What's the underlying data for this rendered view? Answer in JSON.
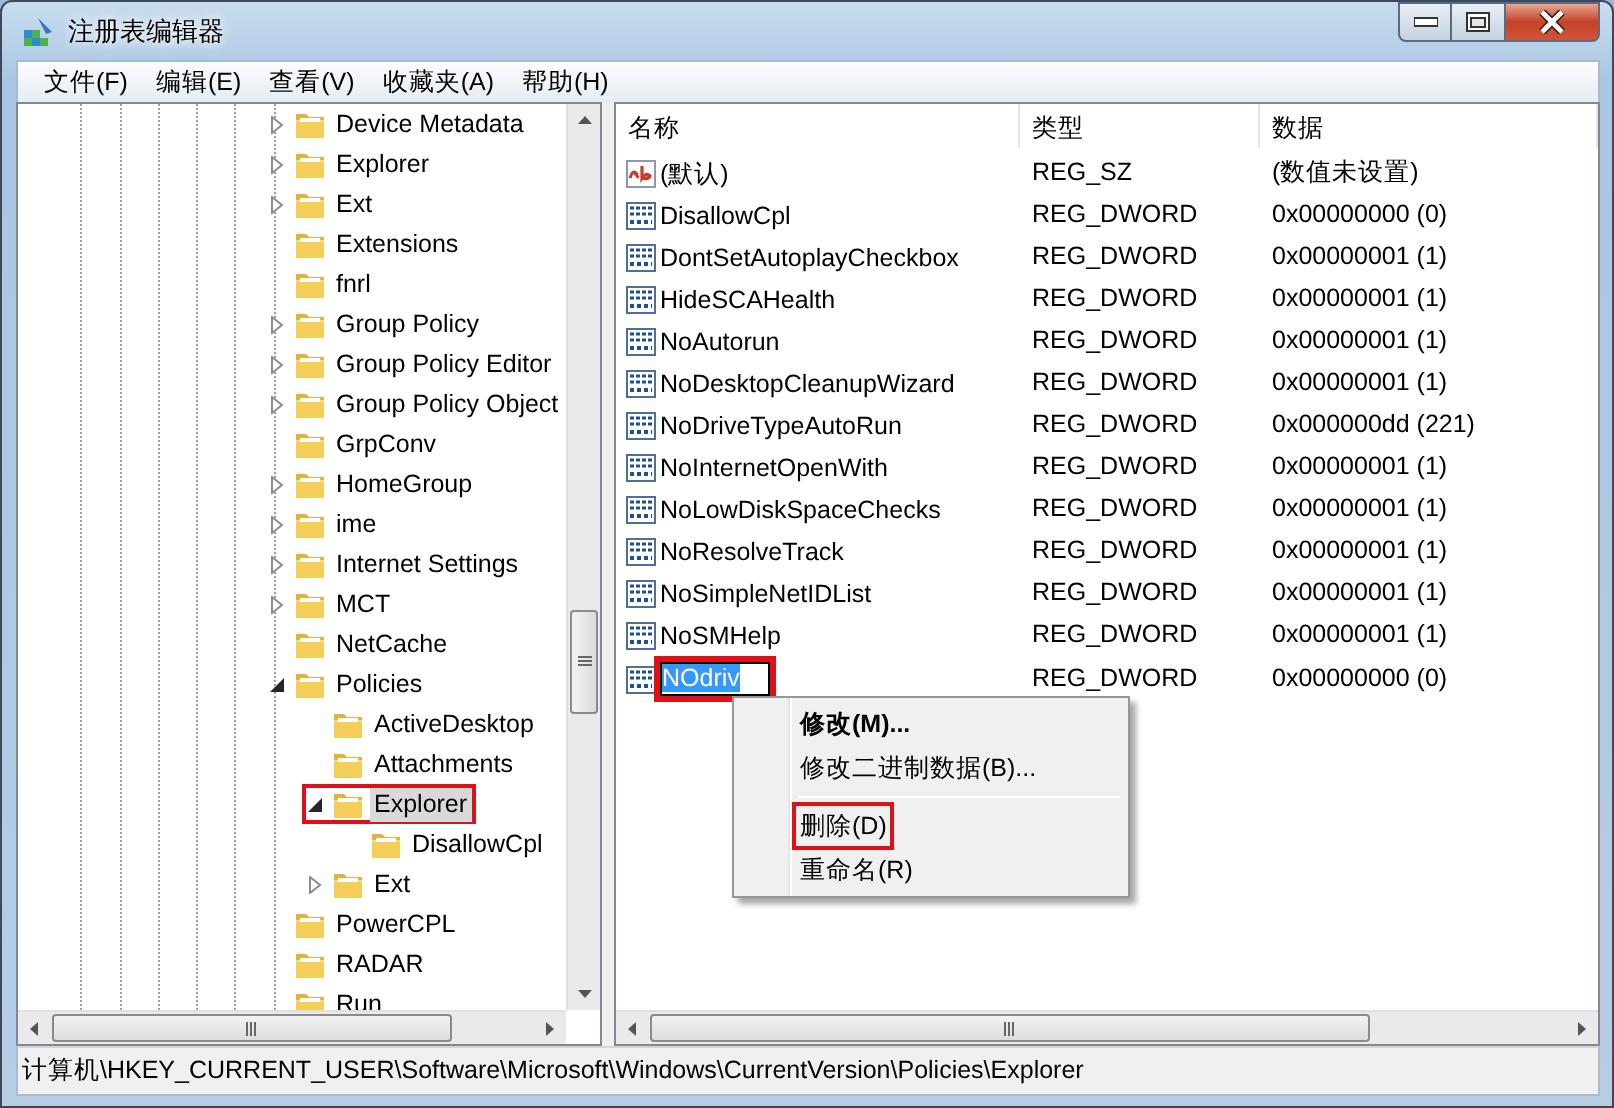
{
  "window": {
    "title": "注册表编辑器"
  },
  "menu": [
    "文件(F)",
    "编辑(E)",
    "查看(V)",
    "收藏夹(A)",
    "帮助(H)"
  ],
  "tree": [
    {
      "label": "Device Metadata",
      "kind": "branch",
      "expanded": false,
      "selected": false,
      "marked": false
    },
    {
      "label": "Explorer",
      "kind": "branch",
      "expanded": false,
      "selected": false,
      "marked": false
    },
    {
      "label": "Ext",
      "kind": "branch",
      "expanded": false,
      "selected": false,
      "marked": false
    },
    {
      "label": "Extensions",
      "kind": "leaf",
      "selected": false,
      "marked": false
    },
    {
      "label": "fnrl",
      "kind": "leaf",
      "selected": false,
      "marked": false
    },
    {
      "label": "Group Policy",
      "kind": "branch",
      "expanded": false,
      "selected": false,
      "marked": false
    },
    {
      "label": "Group Policy Editor",
      "kind": "branch",
      "expanded": false,
      "selected": false,
      "marked": false
    },
    {
      "label": "Group Policy Object",
      "kind": "branch",
      "expanded": false,
      "selected": false,
      "marked": false
    },
    {
      "label": "GrpConv",
      "kind": "leaf",
      "selected": false,
      "marked": false
    },
    {
      "label": "HomeGroup",
      "kind": "branch",
      "expanded": false,
      "selected": false,
      "marked": false
    },
    {
      "label": "ime",
      "kind": "branch",
      "expanded": false,
      "selected": false,
      "marked": false
    },
    {
      "label": "Internet Settings",
      "kind": "branch",
      "expanded": false,
      "selected": false,
      "marked": false
    },
    {
      "label": "MCT",
      "kind": "branch",
      "expanded": false,
      "selected": false,
      "marked": false
    },
    {
      "label": "NetCache",
      "kind": "leaf",
      "selected": false,
      "marked": false
    },
    {
      "label": "Policies",
      "kind": "branch",
      "expanded": true,
      "selected": false,
      "marked": false,
      "children": [
        {
          "label": "ActiveDesktop",
          "kind": "leaf",
          "selected": false,
          "marked": false
        },
        {
          "label": "Attachments",
          "kind": "leaf",
          "selected": false,
          "marked": false
        },
        {
          "label": "Explorer",
          "kind": "branch",
          "expanded": true,
          "selected": true,
          "marked": true,
          "children": [
            {
              "label": "DisallowCpl",
              "kind": "leaf",
              "selected": false,
              "marked": false
            }
          ]
        },
        {
          "label": "Ext",
          "kind": "branch",
          "expanded": false,
          "selected": false,
          "marked": false
        }
      ]
    },
    {
      "label": "PowerCPL",
      "kind": "leaf",
      "selected": false,
      "marked": false
    },
    {
      "label": "RADAR",
      "kind": "leaf",
      "selected": false,
      "marked": false
    },
    {
      "label": "Run",
      "kind": "leaf",
      "selected": false,
      "marked": false
    }
  ],
  "table": {
    "columns": [
      "名称",
      "类型",
      "数据"
    ],
    "rows": [
      {
        "kind": "string",
        "name": "(默认)",
        "type": "REG_SZ",
        "data": "(数值未设置)",
        "selected": false,
        "editing": false,
        "marked": false
      },
      {
        "kind": "dword",
        "name": "DisallowCpl",
        "type": "REG_DWORD",
        "data": "0x00000000 (0)",
        "selected": false,
        "editing": false,
        "marked": false
      },
      {
        "kind": "dword",
        "name": "DontSetAutoplayCheckbox",
        "type": "REG_DWORD",
        "data": "0x00000001 (1)",
        "selected": false,
        "editing": false,
        "marked": false
      },
      {
        "kind": "dword",
        "name": "HideSCAHealth",
        "type": "REG_DWORD",
        "data": "0x00000001 (1)",
        "selected": false,
        "editing": false,
        "marked": false
      },
      {
        "kind": "dword",
        "name": "NoAutorun",
        "type": "REG_DWORD",
        "data": "0x00000001 (1)",
        "selected": false,
        "editing": false,
        "marked": false
      },
      {
        "kind": "dword",
        "name": "NoDesktopCleanupWizard",
        "type": "REG_DWORD",
        "data": "0x00000001 (1)",
        "selected": false,
        "editing": false,
        "marked": false
      },
      {
        "kind": "dword",
        "name": "NoDriveTypeAutoRun",
        "type": "REG_DWORD",
        "data": "0x000000dd (221)",
        "selected": false,
        "editing": false,
        "marked": false
      },
      {
        "kind": "dword",
        "name": "NoInternetOpenWith",
        "type": "REG_DWORD",
        "data": "0x00000001 (1)",
        "selected": false,
        "editing": false,
        "marked": false
      },
      {
        "kind": "dword",
        "name": "NoLowDiskSpaceChecks",
        "type": "REG_DWORD",
        "data": "0x00000001 (1)",
        "selected": false,
        "editing": false,
        "marked": false
      },
      {
        "kind": "dword",
        "name": "NoResolveTrack",
        "type": "REG_DWORD",
        "data": "0x00000001 (1)",
        "selected": false,
        "editing": false,
        "marked": false
      },
      {
        "kind": "dword",
        "name": "NoSimpleNetIDList",
        "type": "REG_DWORD",
        "data": "0x00000001 (1)",
        "selected": false,
        "editing": false,
        "marked": false
      },
      {
        "kind": "dword",
        "name": "NoSMHelp",
        "type": "REG_DWORD",
        "data": "0x00000001 (1)",
        "selected": false,
        "editing": false,
        "marked": false
      },
      {
        "kind": "dword",
        "name": "NOdriv",
        "type": "REG_DWORD",
        "data": "0x00000000 (0)",
        "selected": true,
        "editing": true,
        "marked": true
      }
    ]
  },
  "context_menu": [
    {
      "kind": "item",
      "label": "修改(M)...",
      "default": true,
      "marked": false
    },
    {
      "kind": "item",
      "label": "修改二进制数据(B)...",
      "default": false,
      "marked": false
    },
    {
      "kind": "separator"
    },
    {
      "kind": "item",
      "label": "删除(D)",
      "default": false,
      "marked": true
    },
    {
      "kind": "item",
      "label": "重命名(R)",
      "default": false,
      "marked": false
    }
  ],
  "status_bar": "计算机\\HKEY_CURRENT_USER\\Software\\Microsoft\\Windows\\CurrentVersion\\Policies\\Explorer"
}
